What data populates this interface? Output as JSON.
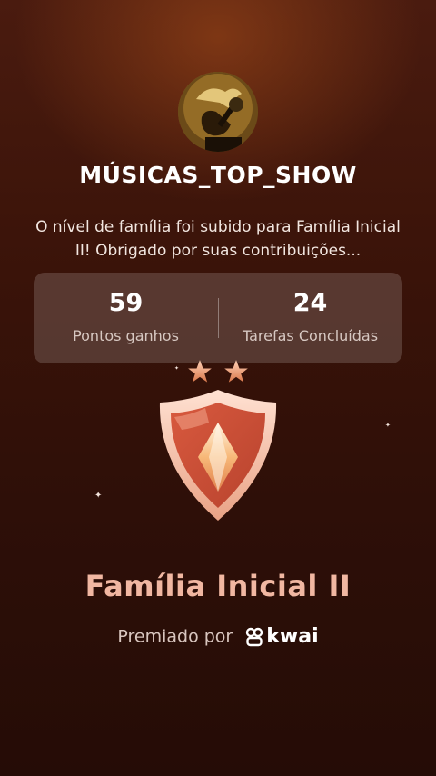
{
  "profile": {
    "username": "MÚSICAS_TOP_SHOW",
    "avatar_icon": "guitar-avatar-icon"
  },
  "message": "O nível de família foi subido para Família Inicial II! Obrigado por suas contribuições...",
  "stats": {
    "points": {
      "value": "59",
      "label": "Pontos ganhos"
    },
    "tasks": {
      "value": "24",
      "label": "Tarefas Concluídas"
    }
  },
  "badge": {
    "stars": 2,
    "name": "Família Inicial II",
    "icon": "shield-diamond-badge-icon"
  },
  "awarded": {
    "prefix": "Premiado por",
    "brand": "kwai",
    "brand_icon": "kwai-logo-icon"
  },
  "colors": {
    "background": "#3a1309",
    "badge_text": "#f1b7a2",
    "accent": "#e8926a"
  }
}
